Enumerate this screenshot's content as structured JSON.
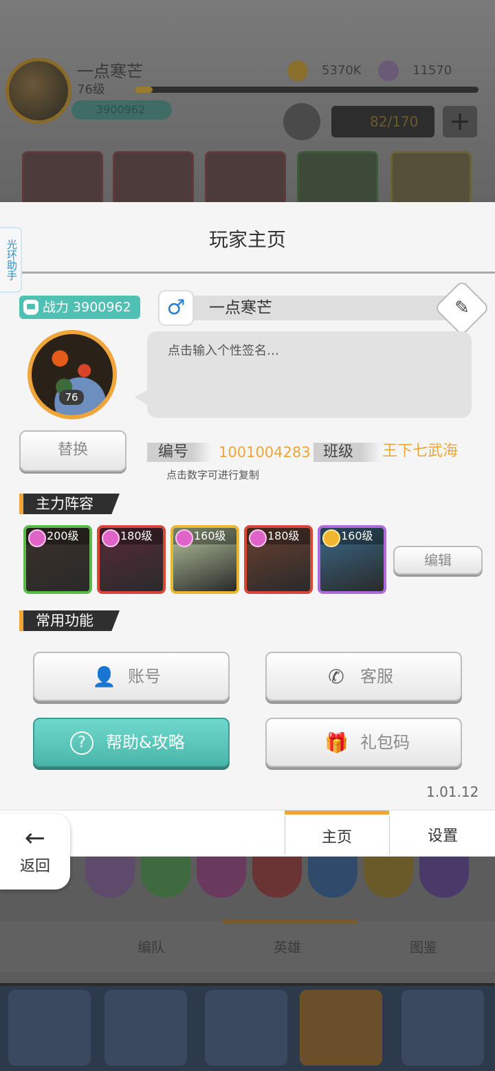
{
  "background": {
    "player_name": "一点寒芒",
    "level": "76级",
    "power": "3900962",
    "gold": "5370K",
    "gems": "11570",
    "slots": "82/170",
    "tabs": [
      "编队",
      "英雄",
      "图鉴"
    ]
  },
  "modal": {
    "title": "玩家主页",
    "side_tab": "光环助手",
    "power_label": "战力 3900962",
    "avatar_level": "76",
    "gender_symbol": "♂",
    "player_name": "一点寒芒",
    "edit_icon": "✎",
    "signature_placeholder": "点击输入个性签名…",
    "replace_button": "替换",
    "id_label": "编号",
    "id_value": "1001004283",
    "class_label": "班级",
    "class_value": "王下七武海",
    "copy_hint": "点击数字可进行复制",
    "lineup_title": "主力阵容",
    "heroes": [
      {
        "level": "200级",
        "gem": "heart",
        "border": "#5bb94a",
        "bg": "#3a3028"
      },
      {
        "level": "180级",
        "gem": "heart",
        "border": "#d8463a",
        "bg": "#5a2a3a"
      },
      {
        "level": "160级",
        "gem": "heart",
        "border": "#e8b832",
        "bg": "#b8c8a0"
      },
      {
        "level": "180级",
        "gem": "heart",
        "border": "#d8463a",
        "bg": "#6a4030"
      },
      {
        "level": "160级",
        "gem": "sun",
        "border": "#b06ad8",
        "bg": "#3a6a8a"
      }
    ],
    "edit_button": "编辑",
    "functions_title": "常用功能",
    "functions": {
      "account": {
        "label": "账号",
        "icon": "👤"
      },
      "service": {
        "label": "客服",
        "icon": "✆"
      },
      "help": {
        "label": "帮助&攻略",
        "icon": "?"
      },
      "gift": {
        "label": "礼包码",
        "icon": "🎁"
      }
    },
    "version": "1.01.12",
    "tabs": {
      "home": "主页",
      "settings": "设置"
    },
    "back_label": "返回",
    "back_icon": "←"
  },
  "colors": {
    "accent": "#f0a53a",
    "teal": "#4fc0b3"
  }
}
